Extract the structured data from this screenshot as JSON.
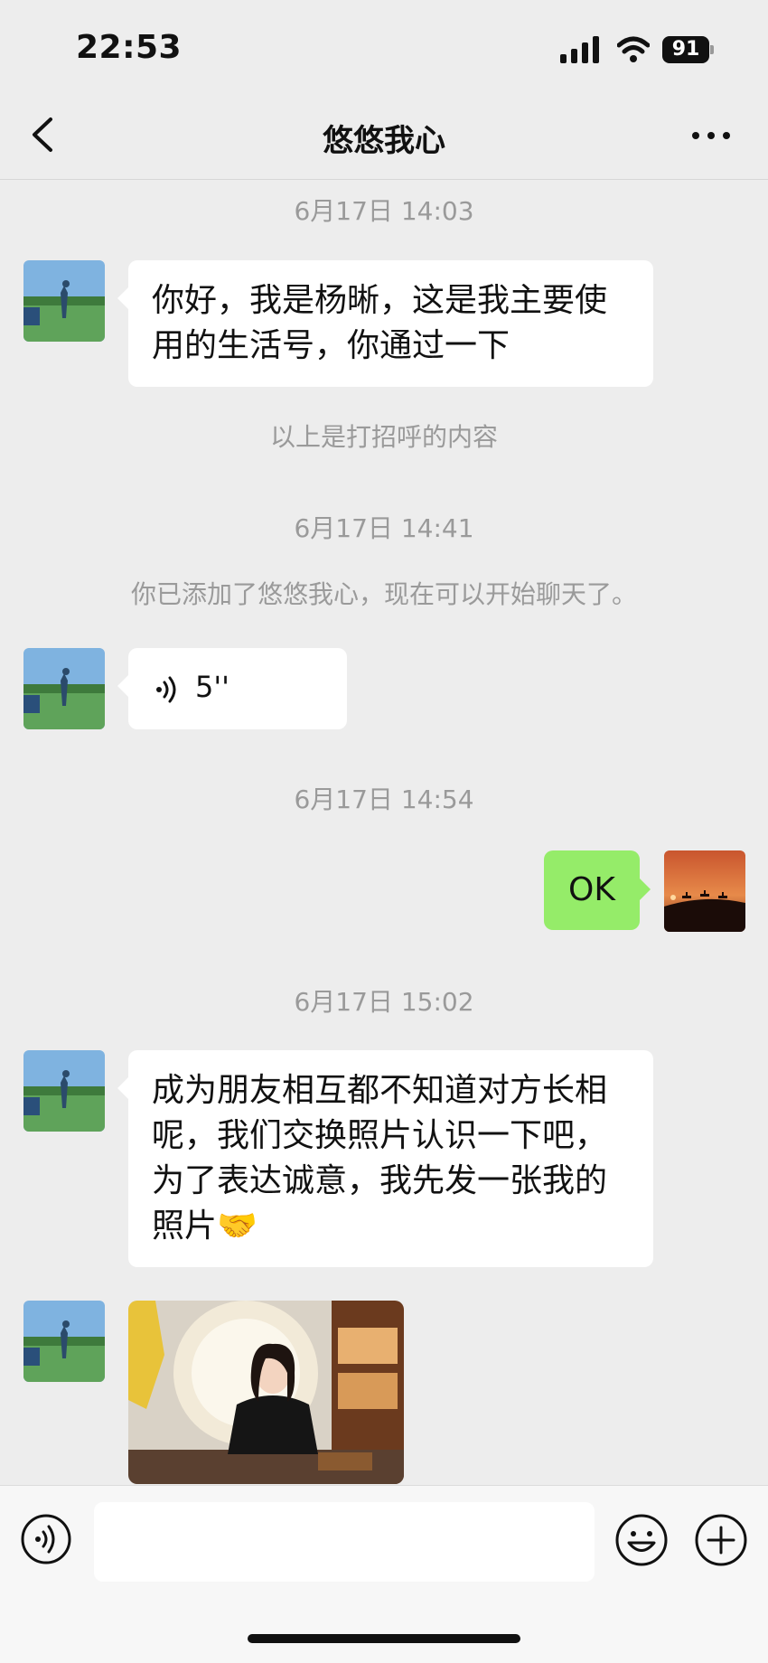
{
  "status_bar": {
    "time": "22:53",
    "battery": "91"
  },
  "header": {
    "title": "悠悠我心"
  },
  "messages": {
    "t1": "6月17日 14:03",
    "greeting": "你好，我是杨晰，这是我主要使用的生活号，你通过一下",
    "greeting_note": "以上是打招呼的内容",
    "t2": "6月17日 14:41",
    "added_note": "你已添加了悠悠我心，现在可以开始聊天了。",
    "voice_duration": "5''",
    "t3": "6月17日 14:54",
    "reply": "OK",
    "t4": "6月17日 15:02",
    "long_msg": "成为朋友相互都不知道对方长相呢，我们交换照片认识一下吧，为了表达诚意，我先发一张我的照片🤝"
  },
  "input": {
    "placeholder": ""
  },
  "colors": {
    "background": "#ededed",
    "bubble_self": "#95ec69",
    "bubble_other": "#ffffff",
    "timestamp": "#9a9a9a"
  },
  "icons": [
    "back-icon",
    "more-icon",
    "signal-icon",
    "wifi-icon",
    "battery-icon",
    "voice-wave-icon",
    "voice-toggle-icon",
    "emoji-icon",
    "plus-icon"
  ]
}
